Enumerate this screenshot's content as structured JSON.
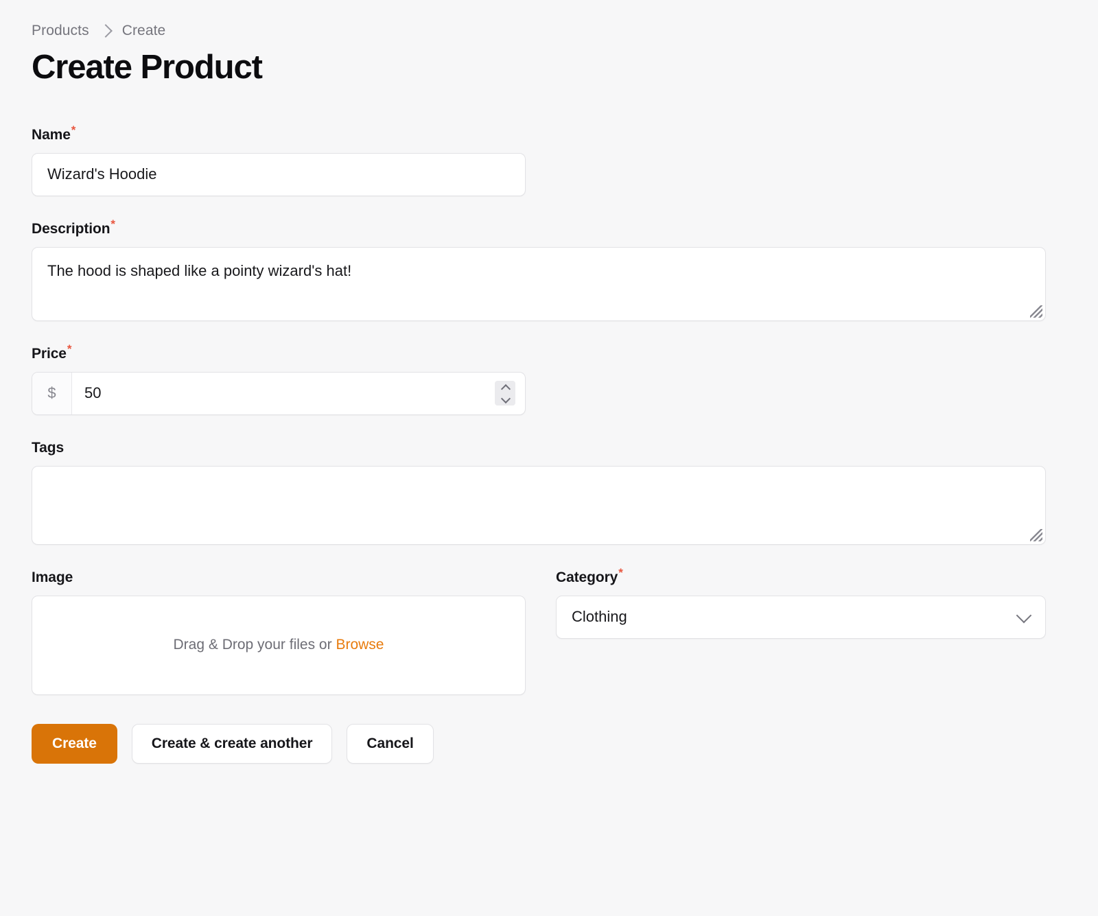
{
  "breadcrumb": {
    "items": [
      {
        "label": "Products"
      },
      {
        "label": "Create"
      }
    ],
    "separator": "chevron-right-icon"
  },
  "header": {
    "title": "Create Product"
  },
  "form": {
    "required_marker": "*",
    "fields": {
      "name": {
        "label": "Name",
        "required": true,
        "value": "Wizard's Hoodie",
        "placeholder": ""
      },
      "description": {
        "label": "Description",
        "required": true,
        "value": "The hood is shaped like a pointy wizard's hat!",
        "placeholder": ""
      },
      "price": {
        "label": "Price",
        "required": true,
        "prefix": "$",
        "value": "50",
        "placeholder": "",
        "stepper_up": "chevron-up-icon",
        "stepper_down": "chevron-down-icon"
      },
      "tags": {
        "label": "Tags",
        "required": false,
        "value": "",
        "placeholder": ""
      },
      "image": {
        "label": "Image",
        "required": false,
        "dropzone_text": "Drag & Drop your files or ",
        "browse_label": "Browse"
      },
      "category": {
        "label": "Category",
        "required": true,
        "value": "Clothing",
        "chevron": "chevron-down-icon"
      }
    }
  },
  "actions": {
    "create_label": "Create",
    "create_another_label": "Create & create another",
    "cancel_label": "Cancel"
  },
  "colors": {
    "accent": "#d97408",
    "link": "#e87b0c",
    "required": "#e8563f",
    "page_background": "#f7f7f8",
    "border": "#e2e2e5",
    "text": "#16161a",
    "muted_text": "#75757d"
  }
}
